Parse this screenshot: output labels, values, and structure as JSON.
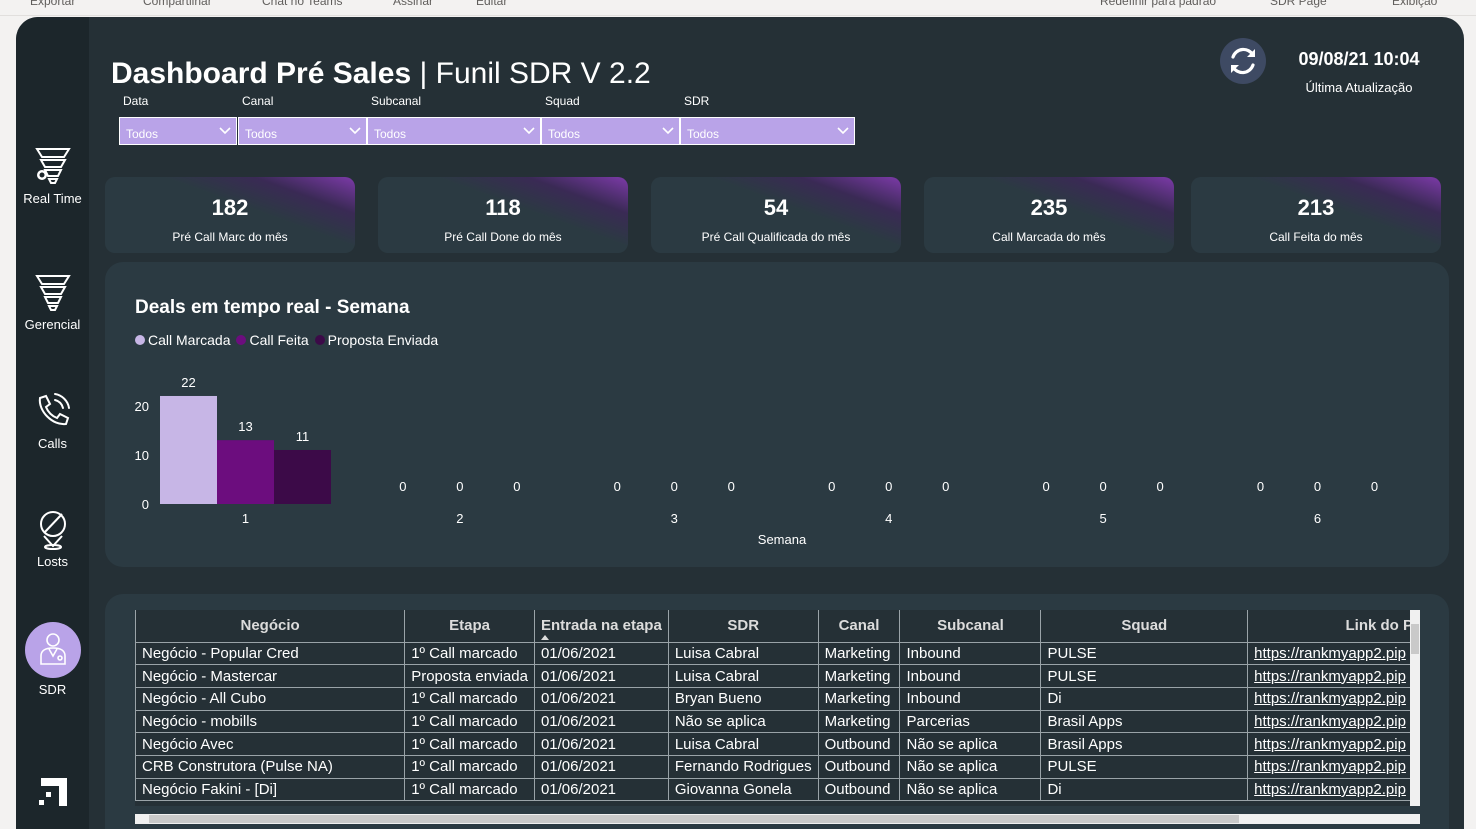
{
  "topbar": {
    "items": [
      "Exportar",
      "Compartilhar",
      "Chat no Teams",
      "Assinar",
      "Editar",
      "Redefinir para padrão",
      "SDR Page",
      "Exibição"
    ]
  },
  "header": {
    "title_bold": "Dashboard Pré Sales",
    "separator": "|",
    "title_light": "Funil SDR V 2.2",
    "update_date": "09/08/21 10:04",
    "update_label": "Última Atualização"
  },
  "nav": {
    "items": [
      {
        "label": "Real Time"
      },
      {
        "label": "Gerencial"
      },
      {
        "label": "Calls"
      },
      {
        "label": "Losts"
      },
      {
        "label": "SDR"
      }
    ]
  },
  "filters": [
    {
      "label": "Data",
      "value": "Todos"
    },
    {
      "label": "Canal",
      "value": "Todos"
    },
    {
      "label": "Subcanal",
      "value": "Todos"
    },
    {
      "label": "Squad",
      "value": "Todos"
    },
    {
      "label": "SDR",
      "value": "Todos"
    }
  ],
  "kpis": [
    {
      "value": "182",
      "label": "Pré Call Marc do mês"
    },
    {
      "value": "118",
      "label": "Pré Call Done do mês"
    },
    {
      "value": "54",
      "label": "Pré Call Qualificada do mês"
    },
    {
      "value": "235",
      "label": "Call Marcada do mês"
    },
    {
      "value": "213",
      "label": "Call Feita do mês"
    }
  ],
  "colors": {
    "call_marcada": "#c7b6e6",
    "call_feita": "#6c0d7e",
    "proposta_enviada": "#3c0a48",
    "panel_bg": "#2b3a42",
    "app_bg": "#253036",
    "filter_bg": "#b9a3e8"
  },
  "chart_data": {
    "type": "bar",
    "title": "Deals em tempo real - Semana",
    "xlabel": "Semana",
    "ylabel": "",
    "categories": [
      "1",
      "2",
      "3",
      "4",
      "5",
      "6"
    ],
    "series": [
      {
        "name": "Call Marcada",
        "values": [
          22,
          0,
          0,
          0,
          0,
          0
        ]
      },
      {
        "name": "Call Feita",
        "values": [
          13,
          0,
          0,
          0,
          0,
          0
        ]
      },
      {
        "name": "Proposta Enviada",
        "values": [
          11,
          0,
          0,
          0,
          0,
          0
        ]
      }
    ],
    "yticks": [
      0,
      10,
      20
    ],
    "ylim": [
      0,
      22
    ],
    "legend": "top-left",
    "grid": false
  },
  "table": {
    "columns": [
      "Negócio",
      "Etapa",
      "Entrada na etapa",
      "SDR",
      "Canal",
      "Subcanal",
      "Squad",
      "Link do P"
    ],
    "rows": [
      [
        "Negócio - Popular Cred",
        "1º Call marcado",
        "01/06/2021",
        "Luisa Cabral",
        "Marketing",
        "Inbound",
        "PULSE",
        "https://rankmyapp2.pip"
      ],
      [
        "Negócio - Mastercar",
        "Proposta enviada",
        "01/06/2021",
        "Luisa Cabral",
        "Marketing",
        "Inbound",
        "PULSE",
        "https://rankmyapp2.pip"
      ],
      [
        "Negócio - All Cubo",
        "1º Call marcado",
        "01/06/2021",
        "Bryan Bueno",
        "Marketing",
        "Inbound",
        "Di",
        "https://rankmyapp2.pip"
      ],
      [
        "Negócio - mobills",
        "1º Call marcado",
        "01/06/2021",
        "Não se aplica",
        "Marketing",
        "Parcerias",
        "Brasil Apps",
        "https://rankmyapp2.pip"
      ],
      [
        "Negócio Avec",
        "1º Call marcado",
        "01/06/2021",
        "Luisa Cabral",
        "Outbound",
        "Não se aplica",
        "Brasil Apps",
        "https://rankmyapp2.pip"
      ],
      [
        "CRB Construtora (Pulse NA)",
        "1º Call marcado",
        "01/06/2021",
        "Fernando Rodrigues",
        "Outbound",
        "Não se aplica",
        "PULSE",
        "https://rankmyapp2.pip"
      ],
      [
        "Negócio Fakini - [Di]",
        "1º Call marcado",
        "01/06/2021",
        "Giovanna Gonela",
        "Outbound",
        "Não se aplica",
        "Di",
        "https://rankmyapp2.pip"
      ]
    ]
  }
}
